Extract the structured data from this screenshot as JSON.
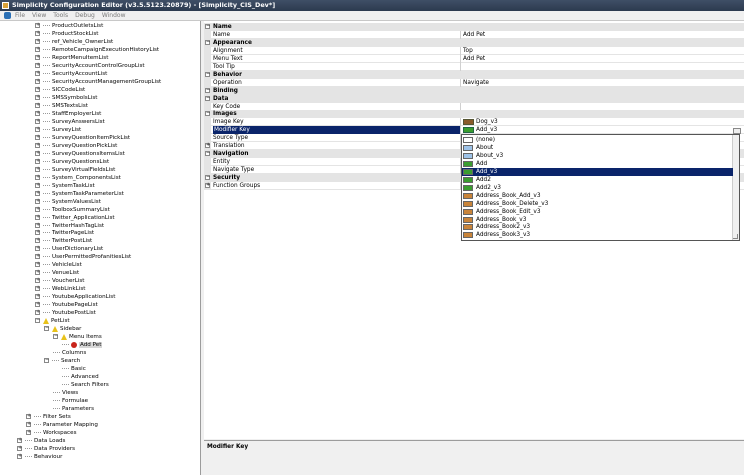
{
  "window": {
    "title": "Simplicity Configuration Editor (v3.5.5123.20879) - [Simplicity_CIS_Dev*]"
  },
  "menu": [
    "File",
    "View",
    "Tools",
    "Debug",
    "Window"
  ],
  "tree": {
    "list_items": [
      "ProductOutletsList",
      "ProductStockList",
      "ref_Vehicle_OwnerList",
      "RemoteCampaignExecutionHistoryList",
      "ReportMenuItemList",
      "SecurityAccountControlGroupList",
      "SecurityAccountList",
      "SecurityAccountManagementGroupList",
      "SICCodeList",
      "SMSSymbolsList",
      "SMSTextsList",
      "StaffEmployerList",
      "SurveyAnswersList",
      "SurveyList",
      "SurveyQuestionItemPickList",
      "SurveyQuestionPickList",
      "SurveyQuestionsItemsList",
      "SurveyQuestionsList",
      "SurveyVirtualFieldsList",
      "System_ComponentsList",
      "SystemTaskList",
      "SystemTaskParameterList",
      "SystemValuesList",
      "ToolboxSummaryList",
      "Twitter_ApplicationList",
      "TwitterHashTagList",
      "TwitterPageList",
      "TwitterPostList",
      "UserDictionaryList",
      "UserPermittedProfanitiesList",
      "VehicleList",
      "VenueList",
      "VoucherList",
      "WebLinkList",
      "YoutubeApplicationList",
      "YoutubePageList",
      "YoutubePostList"
    ],
    "petlist": "PetList",
    "sidebar": "Sidebar",
    "menu_items": "Menu Items",
    "add_pet": "Add Pet",
    "columns": "Columns",
    "search": "Search",
    "basic": "Basic",
    "advanced": "Advanced",
    "search_filters": "Search Filters",
    "views": "Views",
    "formulae": "Formulae",
    "parameters": "Parameters",
    "filter_sets": "Filter Sets",
    "parameter_mapping": "Parameter Mapping",
    "workspaces": "Workspaces",
    "data_loads": "Data Loads",
    "data_providers": "Data Providers",
    "behaviour": "Behaviour"
  },
  "grid": {
    "rows": [
      {
        "cat": true,
        "name": "Name"
      },
      {
        "name": "Name",
        "value": "Add Pet"
      },
      {
        "cat": true,
        "name": "Appearance"
      },
      {
        "name": "Alignment",
        "value": "Top"
      },
      {
        "name": "Menu Text",
        "value": "Add Pet"
      },
      {
        "name": "Tool Tip",
        "value": ""
      },
      {
        "cat": true,
        "name": "Behavior"
      },
      {
        "name": "Operation",
        "value": "Navigate"
      },
      {
        "cat": true,
        "name": "Binding"
      },
      {
        "cat": true,
        "name": "Data"
      },
      {
        "name": "Key Code",
        "value": ""
      },
      {
        "cat": true,
        "name": "Images"
      },
      {
        "name": "Image Key",
        "value": "Dog_v3"
      },
      {
        "name": "Modifier Key",
        "value": "Add_v3",
        "selected": true
      },
      {
        "name": "Source Type",
        "value": ""
      },
      {
        "name": "Translation",
        "value": "",
        "expand": true
      },
      {
        "cat": true,
        "name": "Navigation"
      },
      {
        "name": "Entity",
        "value": ""
      },
      {
        "name": "Navigate Type",
        "value": ""
      },
      {
        "cat": true,
        "name": "Security"
      },
      {
        "name": "Function Groups",
        "value": "",
        "expand": true
      }
    ]
  },
  "dropdown": {
    "items": [
      "(none)",
      "About",
      "About_v3",
      "Add",
      "Add_v3",
      "Add2",
      "Add2_v3",
      "Address_Book_Add_v3",
      "Address_Book_Delete_v3",
      "Address_Book_Edit_v3",
      "Address_Book_v3",
      "Address_Book2_v3",
      "Address_Book3_v3"
    ],
    "selected": "Add_v3"
  },
  "description": {
    "title": "Modifier Key"
  },
  "colors": {
    "selection": "#0a246a",
    "category": "#e4e4e4",
    "titlebar": "#3f4f66"
  }
}
